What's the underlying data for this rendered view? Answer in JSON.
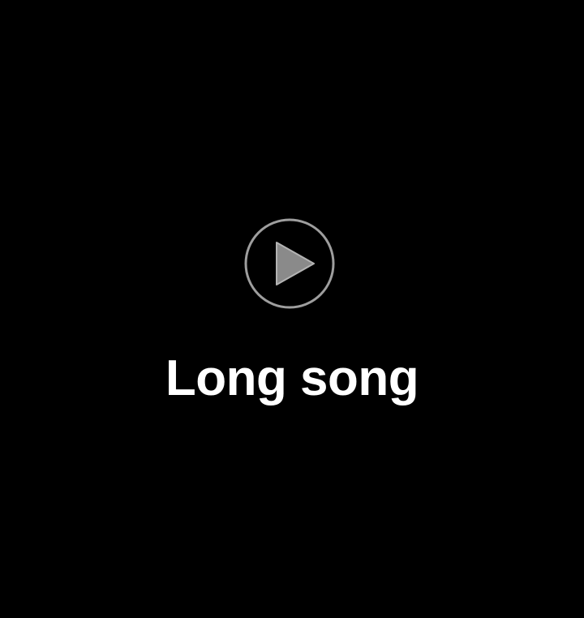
{
  "player": {
    "title": "Long song",
    "play_icon": "play-circle-icon"
  },
  "colors": {
    "background": "#000000",
    "icon": "#9e9e9e",
    "title": "#ffffff"
  }
}
